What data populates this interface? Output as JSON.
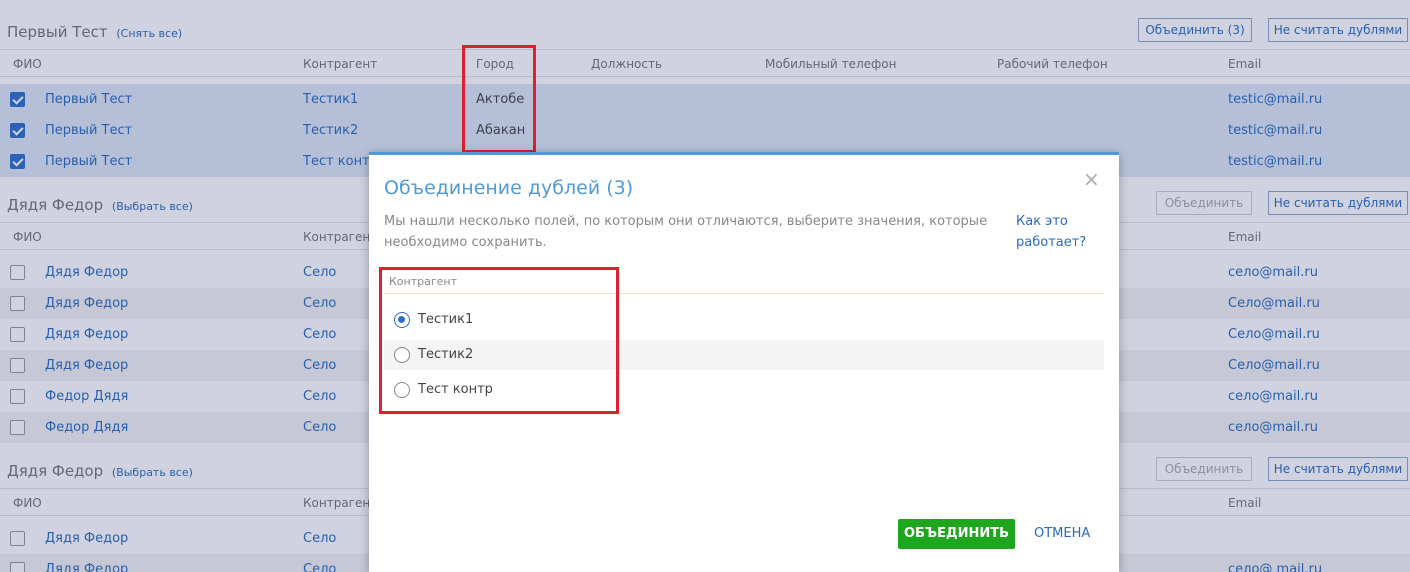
{
  "groups": [
    {
      "title": "Первый Тест",
      "toggle": "(Снять все)",
      "merge_label": "Объединить (3)",
      "not_dup_label": "Не считать дублями",
      "columns": [
        "ФИО",
        "Контрагент",
        "Город",
        "Должность",
        "Мобильный телефон",
        "Рабочий телефон",
        "Email"
      ],
      "rows": [
        {
          "checked": true,
          "fio": "Первый Тест",
          "kontragent": "Тестик1",
          "gorod": "Актобе",
          "email": "testic@mail.ru"
        },
        {
          "checked": true,
          "fio": "Первый Тест",
          "kontragent": "Тестик2",
          "gorod": "Абакан",
          "email": "testic@mail.ru"
        },
        {
          "checked": true,
          "fio": "Первый Тест",
          "kontragent": "Тест контр",
          "gorod": "",
          "email": "testic@mail.ru"
        }
      ]
    },
    {
      "title": "Дядя Федор",
      "toggle": "(Выбрать все)",
      "merge_label": "Объединить",
      "not_dup_label": "Не считать дублями",
      "columns": [
        "ФИО",
        "Контрагент",
        "Email"
      ],
      "rows": [
        {
          "checked": false,
          "fio": "Дядя Федор",
          "kontragent": "Село",
          "email": "село@mail.ru"
        },
        {
          "checked": false,
          "fio": "Дядя Федор",
          "kontragent": "Село",
          "email": "Село@mail.ru"
        },
        {
          "checked": false,
          "fio": "Дядя Федор",
          "kontragent": "Село",
          "email": "Село@mail.ru"
        },
        {
          "checked": false,
          "fio": "Дядя Федор",
          "kontragent": "Село",
          "email": "Село@mail.ru"
        },
        {
          "checked": false,
          "fio": "Федор Дядя",
          "kontragent": "Село",
          "email": "село@mail.ru"
        },
        {
          "checked": false,
          "fio": "Федор Дядя",
          "kontragent": "Село",
          "email": "село@mail.ru"
        }
      ]
    },
    {
      "title": "Дядя Федор",
      "toggle": "(Выбрать все)",
      "merge_label": "Объединить",
      "not_dup_label": "Не считать дублями",
      "columns": [
        "ФИО",
        "Контрагент",
        "Email"
      ],
      "rows": [
        {
          "checked": false,
          "fio": "Дядя Федор",
          "kontragent": "Село",
          "email": ""
        },
        {
          "checked": false,
          "fio": "Дядя Федор",
          "kontragent": "Село",
          "email": "село@ mail.ru"
        }
      ]
    }
  ],
  "modal": {
    "title": "Объединение дублей (3)",
    "close_icon": "×",
    "description": "Мы нашли несколько полей, по которым они отличаются, выберите значения, которые необходимо сохранить.",
    "how_link": "Как это работает?",
    "section_label": "Контрагент",
    "options": [
      {
        "label": "Тестик1",
        "selected": true
      },
      {
        "label": "Тестик2",
        "selected": false
      },
      {
        "label": "Тест контр",
        "selected": false
      }
    ],
    "merge_button": "ОБЪЕДИНИТЬ",
    "cancel_button": "ОТМЕНА"
  },
  "colors": {
    "accent": "#4f9ad6",
    "link": "#2a6bbf",
    "merge_green": "#1fa61f",
    "highlight_red": "#e0202c"
  }
}
